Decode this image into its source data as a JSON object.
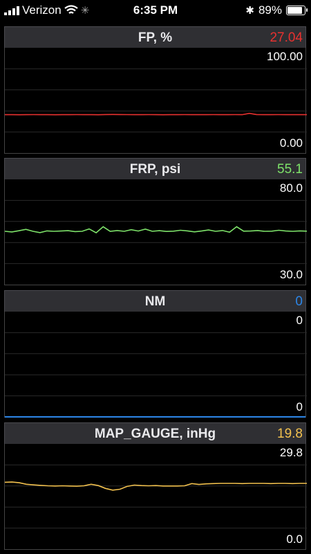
{
  "status_bar": {
    "carrier": "Verizon",
    "time": "6:35 PM",
    "battery": "89%"
  },
  "colors": {
    "fp": "#e8312f",
    "frp": "#7ee36a",
    "nm": "#2c86e8",
    "map": "#f2c14e"
  },
  "panels": [
    {
      "title": "FP, %",
      "value": "27.04",
      "max": "100.00",
      "min": "0.00"
    },
    {
      "title": "FRP, psi",
      "value": "55.1",
      "max": "80.0",
      "min": "30.0"
    },
    {
      "title": "NM",
      "value": "0",
      "max": "0",
      "min": "0"
    },
    {
      "title": "MAP_GAUGE, inHg",
      "value": "19.8",
      "max": "29.8",
      "min": "0.0"
    }
  ],
  "chart_data": [
    {
      "type": "line",
      "title": "FP, %",
      "ylim": [
        0,
        100
      ],
      "grid": true,
      "series": [
        {
          "values": [
            27.0,
            27.0,
            26.9,
            27.0,
            27.1,
            27.0,
            27.0,
            26.9,
            27.0,
            27.0,
            27.1,
            27.0,
            27.0,
            26.9,
            27.2,
            27.3,
            27.2,
            27.1,
            27.0,
            27.0,
            27.1,
            27.0,
            26.9,
            27.0,
            27.0,
            27.1,
            27.0,
            27.0,
            27.0,
            27.1,
            27.0,
            27.0,
            27.1,
            27.0,
            29.0,
            27.2,
            27.0,
            27.0,
            27.1,
            27.0,
            27.0,
            27.0,
            27.0
          ]
        }
      ]
    },
    {
      "type": "line",
      "title": "FRP, psi",
      "ylim": [
        30,
        80
      ],
      "grid": true,
      "series": [
        {
          "values": [
            55.0,
            54.5,
            55.4,
            56.5,
            55.0,
            54.0,
            55.3,
            55.0,
            55.2,
            55.5,
            54.8,
            55.0,
            56.8,
            53.9,
            58.5,
            55.0,
            55.6,
            55.0,
            56.2,
            55.2,
            56.7,
            55.0,
            55.5,
            54.9,
            55.1,
            55.8,
            55.3,
            54.6,
            55.2,
            56.0,
            55.0,
            55.6,
            54.3,
            58.5,
            55.1,
            55.2,
            55.6,
            55.0,
            55.1,
            55.8,
            55.2,
            55.0,
            55.3,
            55.1
          ]
        }
      ]
    },
    {
      "type": "line",
      "title": "NM",
      "ylim": [
        0,
        0
      ],
      "grid": true,
      "series": [
        {
          "values": [
            0,
            0,
            0,
            0,
            0,
            0,
            0,
            0,
            0,
            0
          ]
        }
      ]
    },
    {
      "type": "line",
      "title": "MAP_GAUGE, inHg",
      "ylim": [
        0,
        29.8
      ],
      "grid": true,
      "series": [
        {
          "values": [
            21.1,
            21.2,
            20.9,
            20.2,
            19.9,
            19.7,
            19.5,
            19.4,
            19.5,
            19.4,
            19.3,
            19.5,
            20.2,
            19.6,
            18.3,
            17.5,
            17.9,
            19.2,
            19.8,
            19.6,
            19.5,
            19.6,
            19.4,
            19.4,
            19.4,
            19.5,
            20.5,
            20.1,
            20.4,
            20.5,
            20.6,
            20.6,
            20.6,
            20.5,
            20.6,
            20.6,
            20.6,
            20.5,
            20.6,
            20.6,
            20.5,
            20.6,
            20.6
          ]
        }
      ]
    }
  ]
}
